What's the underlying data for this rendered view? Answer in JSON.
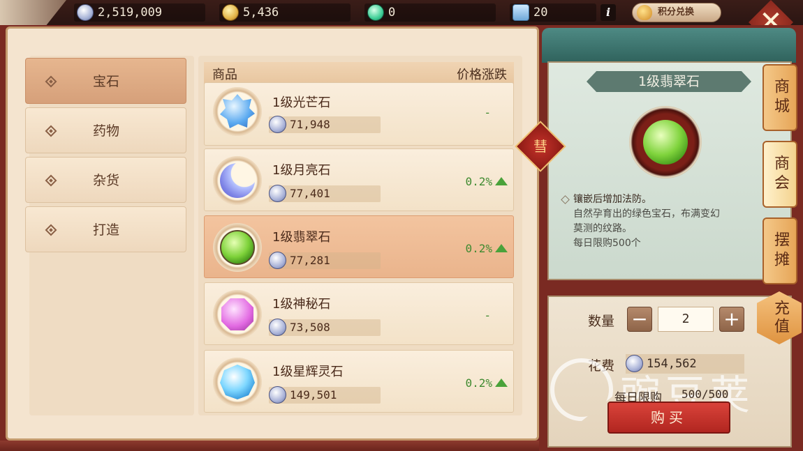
{
  "topbar": {
    "silver": "2,519,009",
    "gold": "5,436",
    "jade": "0",
    "boxes": "20",
    "info_label": "i",
    "points_exchange_label": "积分兑换",
    "close_label": "✕"
  },
  "categories": [
    {
      "label": "宝石",
      "active": true
    },
    {
      "label": "药物",
      "active": false
    },
    {
      "label": "杂货",
      "active": false
    },
    {
      "label": "打造",
      "active": false
    }
  ],
  "list": {
    "header_goods": "商品",
    "header_change": "价格涨跌",
    "items": [
      {
        "name": "1级光芒石",
        "price": "71,948",
        "change": "-",
        "trend": "flat",
        "gem": "blue"
      },
      {
        "name": "1级月亮石",
        "price": "77,401",
        "change": "0.2%",
        "trend": "up",
        "gem": "moon"
      },
      {
        "name": "1级翡翠石",
        "price": "77,281",
        "change": "0.2%",
        "trend": "up",
        "gem": "green",
        "selected": true
      },
      {
        "name": "1级神秘石",
        "price": "73,508",
        "change": "-",
        "trend": "flat",
        "gem": "pink"
      },
      {
        "name": "1级星辉灵石",
        "price": "149,501",
        "change": "0.2%",
        "trend": "up",
        "gem": "star"
      }
    ]
  },
  "detail": {
    "title": "1级翡翠石",
    "knot_glyph": "彗",
    "effect": "镶嵌后增加法防。",
    "description": "自然孕育出的绿色宝石，布满变幻莫测的纹路。",
    "daily_limit_text": "每日限购500个"
  },
  "purchase": {
    "quantity_label": "数量",
    "quantity": "2",
    "minus_label": "−",
    "plus_label": "+",
    "cost_label": "花费",
    "cost": "154,562",
    "limit_label": "每日限购",
    "limit_value": "500/500",
    "buy_label": "购买"
  },
  "side_tabs": [
    {
      "label": "商城",
      "active": false
    },
    {
      "label": "商会",
      "active": true
    },
    {
      "label": "摆摊",
      "active": false
    }
  ],
  "recharge_label": "充值",
  "watermark_text": "豌豆荚",
  "colors": {
    "frame": "#7a2a22",
    "panel": "#f4e4cf",
    "selected": "#eab48c",
    "up": "#4aa23a",
    "buy": "#c8322a"
  }
}
